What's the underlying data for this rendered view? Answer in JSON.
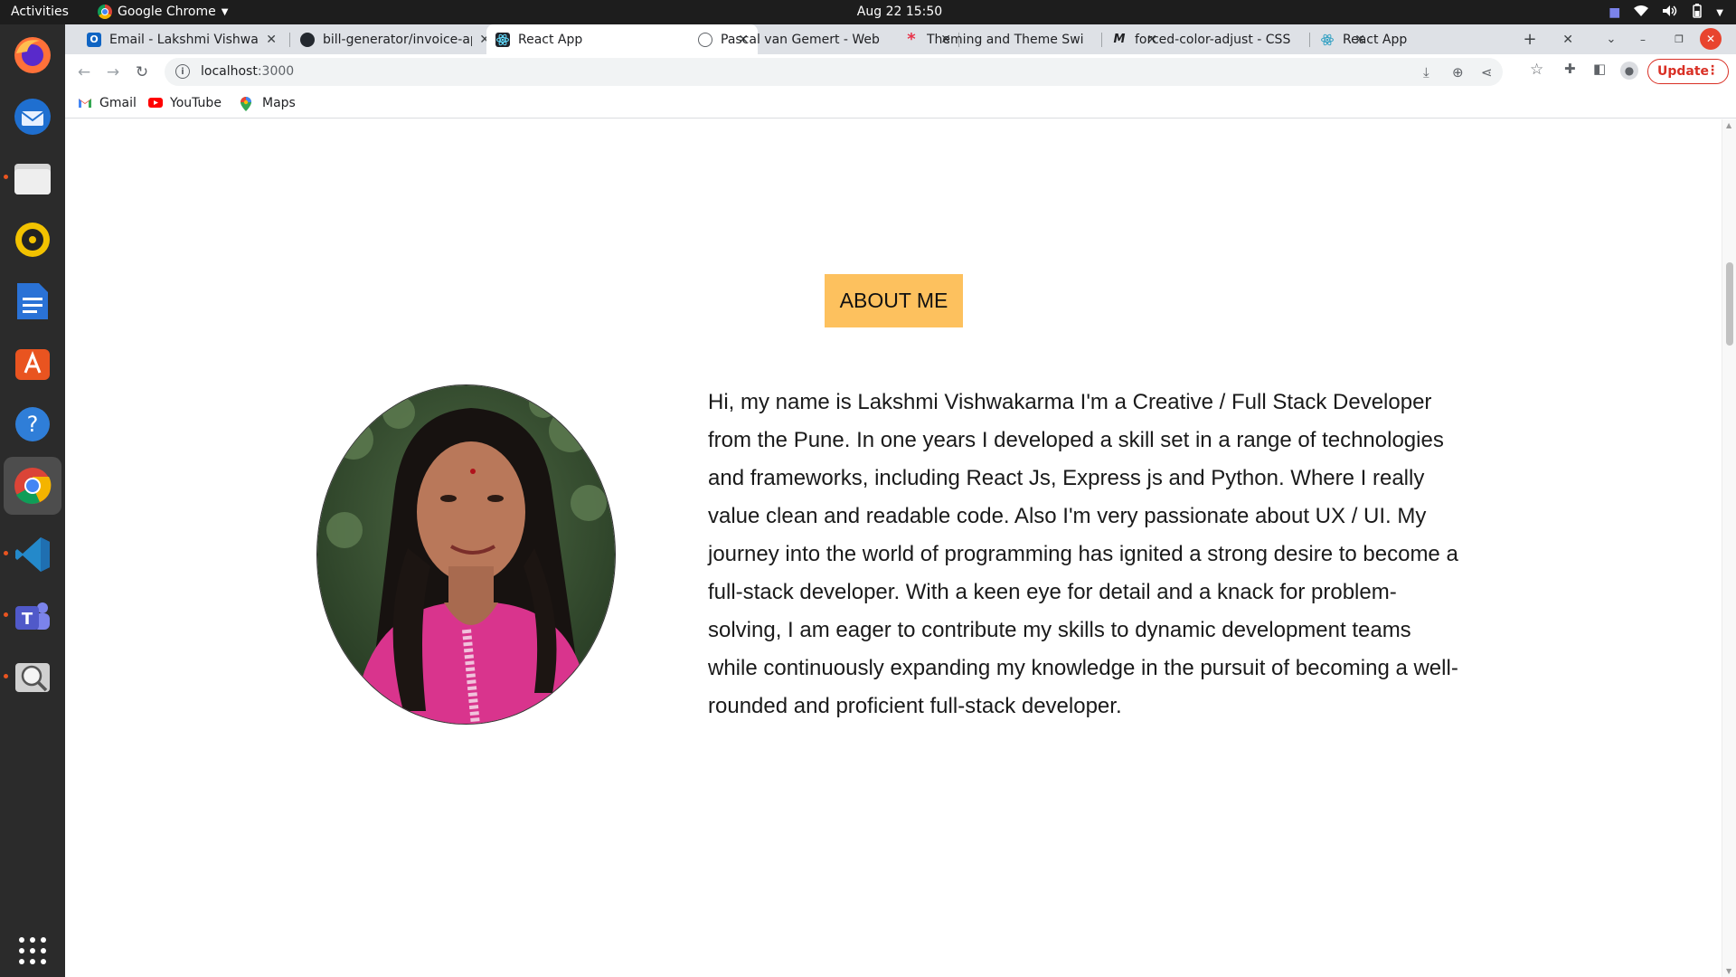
{
  "system": {
    "activities": "Activities",
    "app_name": "Google Chrome",
    "clock": "Aug 22  15:50"
  },
  "tabs": [
    {
      "title": "Email - Lakshmi Vishwak",
      "active": false,
      "icon": "outlook-icon"
    },
    {
      "title": "bill-generator/invoice-ap",
      "active": false,
      "icon": "github-icon"
    },
    {
      "title": "React App",
      "active": true,
      "icon": "react-icon"
    },
    {
      "title": "Pascal van Gemert - Web",
      "active": false,
      "icon": "globe-icon"
    },
    {
      "title": "Theming and Theme Swi",
      "active": false,
      "icon": "asterisk-icon"
    },
    {
      "title": "forced-color-adjust - CSS",
      "active": false,
      "icon": "mdn-icon"
    },
    {
      "title": "React App",
      "active": false,
      "icon": "react-icon"
    }
  ],
  "toolbar": {
    "url_host": "localhost",
    "url_port": ":3000",
    "update_label": "Update"
  },
  "bookmarks": [
    {
      "label": "Gmail",
      "icon": "gmail-icon"
    },
    {
      "label": "YouTube",
      "icon": "youtube-icon"
    },
    {
      "label": "Maps",
      "icon": "maps-icon"
    }
  ],
  "page": {
    "heading": "ABOUT ME",
    "bio": "Hi, my name is Lakshmi Vishwakarma I'm a Creative / Full Stack Developer from the Pune. In one years I developed a skill set in a range of technologies and frameworks, including React Js, Express js and Python. Where I really value clean and readable code. Also I'm very passionate about UX / UI. My journey into the world of programming has ignited a strong desire to become a full-stack developer. With a keen eye for detail and a knack for problem-solving, I am eager to contribute my skills to dynamic development teams while continuously expanding my knowledge in the pursuit of becoming a well-rounded and proficient full-stack developer."
  },
  "colors": {
    "heading_bg": "#fdc15e",
    "update_red": "#d93025",
    "tabstrip_bg": "#dee1e6"
  }
}
